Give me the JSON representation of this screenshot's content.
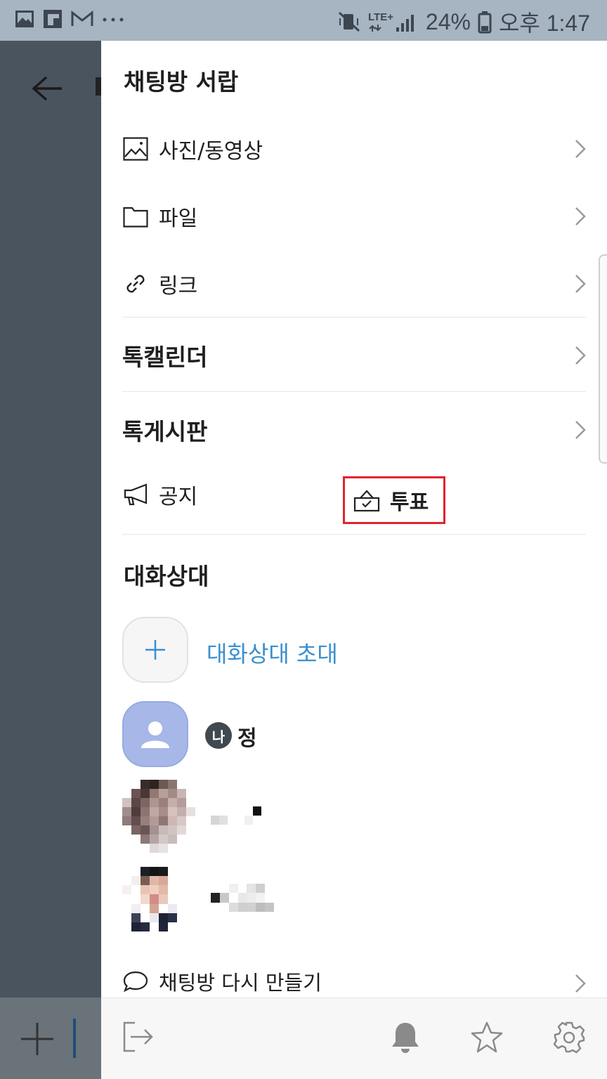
{
  "status_bar": {
    "battery": "24%",
    "network": "LTE+",
    "time": "오후 1:47",
    "left_icons": [
      "gallery-icon",
      "flipboard-icon",
      "gmail-icon",
      "more-dots-icon"
    ]
  },
  "drawer": {
    "title": "채팅방 서랍",
    "media_items": [
      {
        "label": "사진/동영상",
        "icon": "photo-icon"
      },
      {
        "label": "파일",
        "icon": "folder-icon"
      },
      {
        "label": "링크",
        "icon": "link-icon"
      }
    ],
    "calendar": "톡캘린더",
    "board": "톡게시판",
    "notice": "공지",
    "vote": "투표",
    "members_title": "대화상대",
    "invite_label": "대화상대 초대",
    "me_badge": "나",
    "me_name": "정",
    "recreate_label": "채팅방 다시 만들기"
  },
  "colors": {
    "accent": "#3a8fcf",
    "highlight_box": "#e0242e",
    "status_bar": "#a7b4c1",
    "overlay": "#4a545e"
  }
}
